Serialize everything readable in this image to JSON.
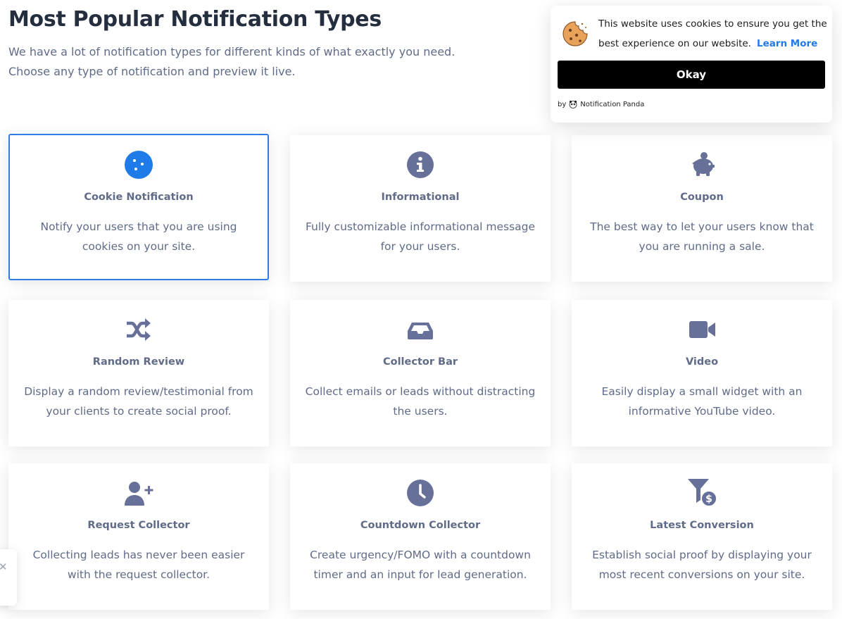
{
  "header": {
    "title": "Most Popular Notification Types",
    "subtitle_line1": "We have a lot of notification types for different kinds of what exactly you need.",
    "subtitle_line2": "Choose any type of notification and preview it live."
  },
  "colors": {
    "accent": "#1e7be8",
    "icon_gray": "#667099",
    "text_gray": "#5f6b88",
    "heading": "#252e3f"
  },
  "cards": [
    {
      "title": "Cookie Notification",
      "desc": "Notify your users that you are using cookies on your site.",
      "icon": "cookie-icon",
      "selected": true
    },
    {
      "title": "Informational",
      "desc": "Fully customizable informational message for your users.",
      "icon": "info-icon"
    },
    {
      "title": "Coupon",
      "desc": "The best way to let your users know that you are running a sale.",
      "icon": "piggy-bank-icon"
    },
    {
      "title": "Random Review",
      "desc": "Display a random review/testimonial from your clients to create social proof.",
      "icon": "shuffle-icon"
    },
    {
      "title": "Collector Bar",
      "desc": "Collect emails or leads without distracting the users.",
      "icon": "inbox-icon"
    },
    {
      "title": "Video",
      "desc": "Easily display a small widget with an informative YouTube video.",
      "icon": "video-camera-icon"
    },
    {
      "title": "Request Collector",
      "desc": "Collecting leads has never been easier with the request collector.",
      "icon": "user-plus-icon"
    },
    {
      "title": "Countdown Collector",
      "desc": "Create urgency/FOMO with a countdown timer and an input for lead generation.",
      "icon": "clock-icon"
    },
    {
      "title": "Latest Conversion",
      "desc": "Establish social proof by displaying your most recent conversions on your site.",
      "icon": "funnel-dollar-icon"
    }
  ],
  "cookie_popup": {
    "message": "This website uses cookies to ensure you get the best experience on our website.",
    "learn_more": "Learn More",
    "button": "Okay",
    "branding": "by",
    "brand_name": "Notification Panda"
  },
  "side_tab": {
    "close": "✕"
  }
}
